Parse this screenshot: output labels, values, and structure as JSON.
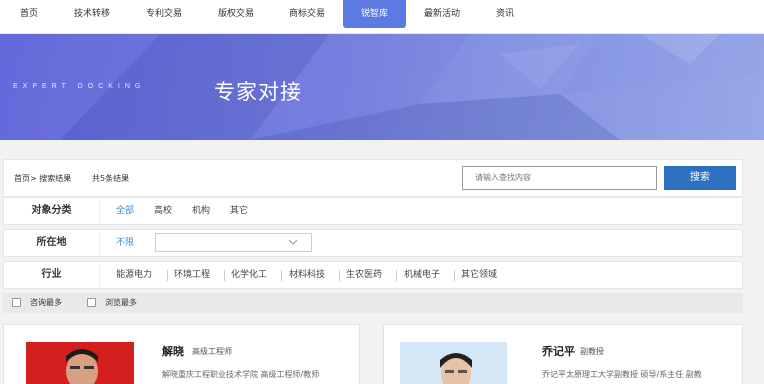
{
  "nav": {
    "items": [
      {
        "label": "首页"
      },
      {
        "label": "技术转移"
      },
      {
        "label": "专利交易"
      },
      {
        "label": "版权交易"
      },
      {
        "label": "商标交易"
      },
      {
        "label": "锐智库"
      },
      {
        "label": "最新活动"
      },
      {
        "label": "资讯"
      }
    ],
    "active_index": 5
  },
  "banner": {
    "subtitle_en": "EXPERT DOCKING",
    "title": "专家对接"
  },
  "breadcrumb": {
    "text": "首页> 搜索结果",
    "result_count": "共5条结果"
  },
  "search": {
    "placeholder": "请输入查找内容",
    "button_label": "搜索"
  },
  "filters": {
    "object": {
      "label": "对象分类",
      "options": [
        "全部",
        "高校",
        "机构",
        "其它"
      ],
      "selected": "全部"
    },
    "location": {
      "label": "所在地",
      "options": [
        "不限"
      ],
      "selected": "不限",
      "select_value": ""
    },
    "industry": {
      "label": "行业",
      "options": [
        "能源电力",
        "环境工程",
        "化学化工",
        "材料科技",
        "生农医药",
        "机械电子",
        "其它领域"
      ]
    }
  },
  "sort": {
    "options": [
      {
        "label": "咨询最多",
        "checked": false
      },
      {
        "label": "浏览最多",
        "checked": false
      }
    ]
  },
  "experts": [
    {
      "name": "解晓",
      "title": "高级工程师",
      "description": "解晓重庆工程职业技术学院  高级工程师/教师"
    },
    {
      "name": "乔记平",
      "title": "副教授",
      "description": "乔记平太原理工大学副教授  硕导/系主任 副教"
    }
  ],
  "colors": {
    "accent": "#5b7be3",
    "search_button": "#2d6fc1",
    "selected_option": "#3a8fd8"
  }
}
